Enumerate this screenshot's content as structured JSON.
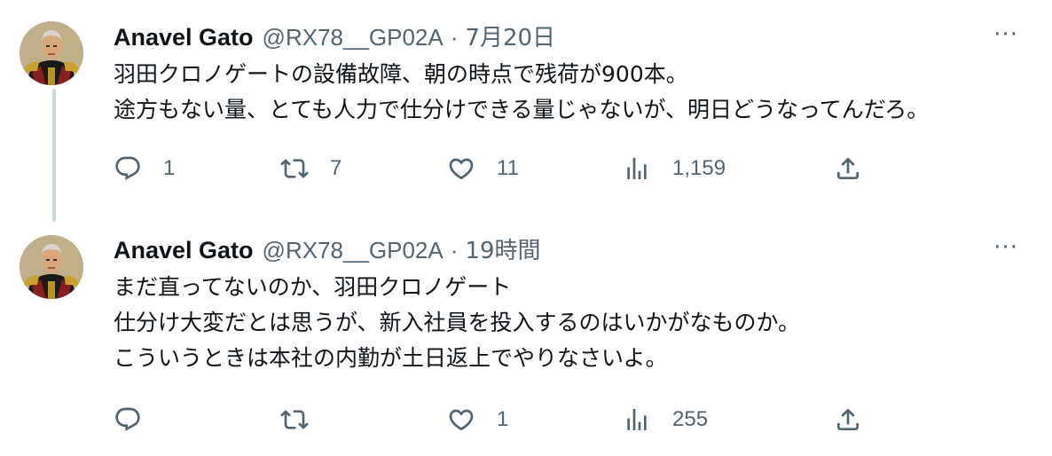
{
  "tweets": [
    {
      "author_name": "Anavel Gato",
      "handle": "@RX78__GP02A",
      "separator": "·",
      "time": "7月20日",
      "more": "···",
      "lines": [
        "羽田クロノゲートの設備故障、朝の時点で残荷が900本。",
        "途方もない量、とても人力で仕分けできる量じゃないが、明日どうなってんだろ。"
      ],
      "replies": "1",
      "retweets": "7",
      "likes": "11",
      "views": "1,159"
    },
    {
      "author_name": "Anavel Gato",
      "handle": "@RX78__GP02A",
      "separator": "·",
      "time": "19時間",
      "more": "···",
      "lines": [
        "まだ直ってないのか、羽田クロノゲート",
        "仕分け大変だとは思うが、新入社員を投入するのはいかがなものか。",
        "こういうときは本社の内勤が土日返上でやりなさいよ。"
      ],
      "replies": "",
      "retweets": "",
      "likes": "1",
      "views": "255"
    }
  ],
  "icons": {
    "reply": "reply-icon",
    "retweet": "retweet-icon",
    "like": "heart-icon",
    "views": "views-icon",
    "share": "share-icon",
    "more": "more-icon"
  },
  "colors": {
    "text": "#0f1419",
    "secondary": "#536471",
    "thread_line": "#cfd9de"
  }
}
